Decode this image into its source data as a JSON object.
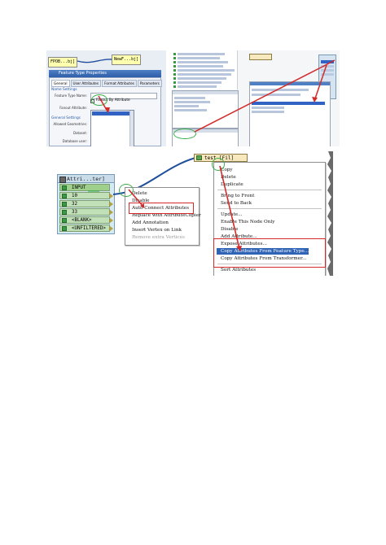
{
  "top_left": {
    "node_left": "FPOB...bj]",
    "node_right": "NewF...bj]",
    "dialog_title": "Feature Type Properties",
    "tabs": [
      {
        "label": "General"
      },
      {
        "label": "User Attributes"
      },
      {
        "label": "Format Attributes"
      },
      {
        "label": "Parameters"
      }
    ],
    "name_settings": "Name Settings",
    "feature_type_name_label": "Feature Type Name:",
    "fanout_checkbox_label": "Fanout By Attribute",
    "fanout_attribute_label": "Fanout Attribute:",
    "general_settings": "General Settings",
    "allowed_geometries_label": "Allowed Geometries:",
    "dataset_label": "Dataset:",
    "database_user_label": "Database user:"
  },
  "bottom": {
    "attr_node_title": "Attri...ter]",
    "attr_rows": [
      {
        "label": "INPUT"
      },
      {
        "label": "10"
      },
      {
        "label": "32"
      },
      {
        "label": "33"
      },
      {
        "label": "<BLANK>"
      },
      {
        "label": "<UNFILTERED>"
      }
    ],
    "transformer_label": "test [Fil]",
    "link_menu": [
      {
        "label": "Delete",
        "enabled": true
      },
      {
        "label": "Disable",
        "enabled": true
      },
      {
        "label": "Auto Connect Attributes",
        "enabled": true
      },
      {
        "label": "Replace with AttributeCopier",
        "enabled": true
      },
      {
        "label": "Add Annotation",
        "enabled": true
      },
      {
        "label": "Insert Vertex on Link",
        "enabled": true
      },
      {
        "label": "Remove extra Vertices",
        "enabled": false
      }
    ],
    "node_menu": [
      {
        "label": "Copy",
        "enabled": true
      },
      {
        "label": "Delete",
        "enabled": true
      },
      {
        "label": "Duplicate",
        "enabled": true
      },
      {
        "label": "Bring to Front",
        "enabled": true
      },
      {
        "label": "Send to Back",
        "enabled": true
      },
      {
        "label": "Update...",
        "enabled": true
      },
      {
        "label": "Enable This Node Only",
        "enabled": true
      },
      {
        "label": "Disable",
        "enabled": true
      },
      {
        "label": "Add Attribute...",
        "enabled": true
      },
      {
        "label": "Expose Attributes...",
        "enabled": true
      },
      {
        "label": "Copy Attributes From Feature Type...",
        "enabled": true
      },
      {
        "label": "Copy Attributes From Transformer...",
        "enabled": true
      },
      {
        "label": "Sort Attributes",
        "enabled": true
      }
    ]
  },
  "colors": {
    "highlight": "#2f63b6",
    "annotation_red": "#d42a2a",
    "annotation_green": "#3bb04a",
    "link_blue": "#1f4f9c"
  }
}
